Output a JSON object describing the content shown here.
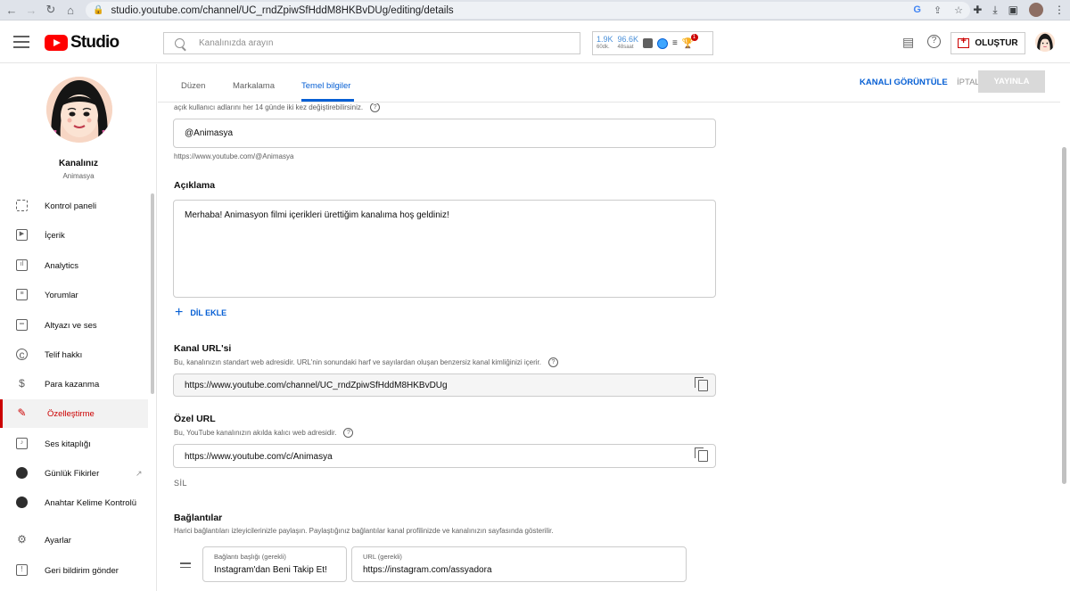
{
  "browser": {
    "url": "studio.youtube.com/channel/UC_rndZpiwSfHddM8HKBvDUg/editing/details"
  },
  "header": {
    "logo_text": "Studio",
    "search_placeholder": "Kanalınızda arayın",
    "stats": [
      {
        "value": "1.9K",
        "label": "60dk."
      },
      {
        "value": "96.6K",
        "label": "48saat"
      }
    ],
    "notification_count": "1",
    "create_label": "OLUŞTUR"
  },
  "sidebar": {
    "channel_title": "Kanalınız",
    "channel_name": "Animasya",
    "items": [
      {
        "label": "Kontrol paneli"
      },
      {
        "label": "İçerik"
      },
      {
        "label": "Analytics"
      },
      {
        "label": "Yorumlar"
      },
      {
        "label": "Altyazı ve ses"
      },
      {
        "label": "Telif hakkı"
      },
      {
        "label": "Para kazanma"
      },
      {
        "label": "Özelleştirme"
      },
      {
        "label": "Ses kitaplığı"
      },
      {
        "label": "Günlük Fikirler"
      },
      {
        "label": "Anahtar Kelime Kontrolü"
      },
      {
        "label": "Ayarlar"
      },
      {
        "label": "Geri bildirim gönder"
      }
    ]
  },
  "tabs": {
    "items": [
      "Düzen",
      "Markalama",
      "Temel bilgiler"
    ],
    "active": "Temel bilgiler",
    "view_channel": "KANALI GÖRÜNTÜLE",
    "cancel": "İPTAL",
    "publish": "YAYINLA"
  },
  "content": {
    "handle_hint": "açık kullanıcı adlarını her 14 günde iki kez değiştirebilirsiniz.",
    "handle_value": "@Animasya",
    "handle_url": "https://www.youtube.com/@Animasya",
    "description_title": "Açıklama",
    "description_value": "Merhaba! Animasyon filmi içerikleri ürettiğim kanalıma hoş geldiniz!",
    "add_language": "DİL EKLE",
    "channel_url_title": "Kanal URL'si",
    "channel_url_hint": "Bu, kanalınızın standart web adresidir. URL'nin sonundaki harf ve sayılardan oluşan benzersiz kanal kimliğinizi içerir.",
    "channel_url_value": "https://www.youtube.com/channel/UC_rndZpiwSfHddM8HKBvDUg",
    "custom_url_title": "Özel URL",
    "custom_url_hint": "Bu, YouTube kanalınızın akılda kalıcı web adresidir.",
    "custom_url_value": "https://www.youtube.com/c/Animasya",
    "delete_label": "SİL",
    "links_title": "Bağlantılar",
    "links_hint": "Harici bağlantıları izleyicilerinizle paylaşın. Paylaştığınız bağlantılar kanal profilinizde ve kanalınızın sayfasında gösterilir.",
    "link": {
      "title_caption": "Bağlantı başlığı (gerekli)",
      "title_value": "Instagram'dan Beni Takip Et!",
      "url_caption": "URL (gerekli)",
      "url_value": "https://instagram.com/assyadora"
    }
  }
}
